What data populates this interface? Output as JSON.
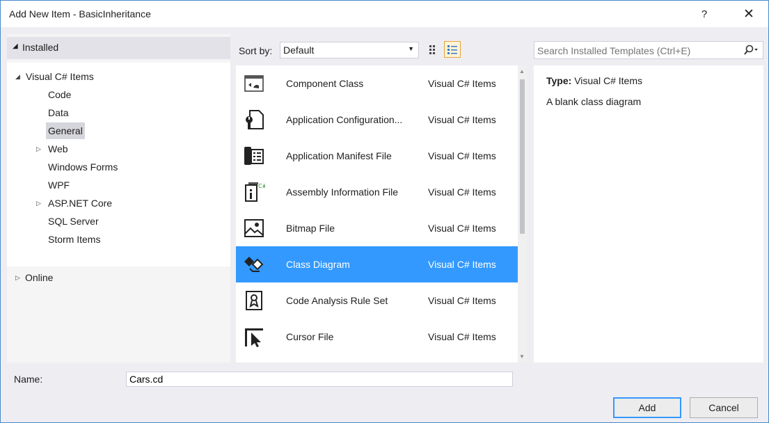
{
  "window": {
    "title": "Add New Item - BasicInheritance",
    "help_label": "?",
    "close_label": "✕"
  },
  "left": {
    "installed_label": "Installed",
    "tree": {
      "root_label": "Visual C# Items",
      "items": [
        {
          "label": "Code",
          "expandable": false
        },
        {
          "label": "Data",
          "expandable": false
        },
        {
          "label": "General",
          "expandable": false,
          "selected": true
        },
        {
          "label": "Web",
          "expandable": true
        },
        {
          "label": "Windows Forms",
          "expandable": false
        },
        {
          "label": "WPF",
          "expandable": false
        },
        {
          "label": "ASP.NET Core",
          "expandable": true
        },
        {
          "label": "SQL Server",
          "expandable": false
        },
        {
          "label": "Storm Items",
          "expandable": false
        }
      ]
    },
    "online_label": "Online"
  },
  "sort": {
    "label": "Sort by:",
    "value": "Default"
  },
  "templates": [
    {
      "name": "Component Class",
      "lang": "Visual C# Items",
      "icon": "component-class-icon"
    },
    {
      "name": "Application Configuration...",
      "lang": "Visual C# Items",
      "icon": "app-config-icon"
    },
    {
      "name": "Application Manifest File",
      "lang": "Visual C# Items",
      "icon": "manifest-icon"
    },
    {
      "name": "Assembly Information File",
      "lang": "Visual C# Items",
      "icon": "assembly-info-icon"
    },
    {
      "name": "Bitmap File",
      "lang": "Visual C# Items",
      "icon": "bitmap-icon"
    },
    {
      "name": "Class Diagram",
      "lang": "Visual C# Items",
      "icon": "class-diagram-icon",
      "selected": true
    },
    {
      "name": "Code Analysis Rule Set",
      "lang": "Visual C# Items",
      "icon": "rule-set-icon"
    },
    {
      "name": "Cursor File",
      "lang": "Visual C# Items",
      "icon": "cursor-icon"
    }
  ],
  "search": {
    "placeholder": "Search Installed Templates (Ctrl+E)"
  },
  "details": {
    "type_label": "Type:",
    "type_value": "Visual C# Items",
    "description": "A blank class diagram"
  },
  "name_field": {
    "label": "Name:",
    "value": "Cars.cd"
  },
  "buttons": {
    "add": "Add",
    "cancel": "Cancel"
  },
  "colors": {
    "accent": "#3399ff",
    "border": "#4a88c9"
  }
}
